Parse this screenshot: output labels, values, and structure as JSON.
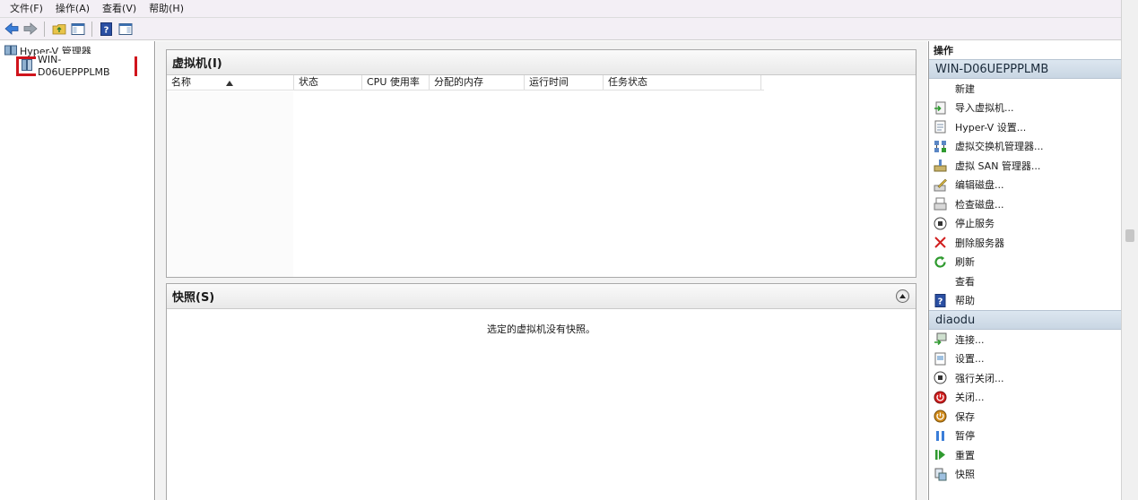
{
  "menu": [
    "文件(F)",
    "操作(A)",
    "查看(V)",
    "帮助(H)"
  ],
  "tree": {
    "root": "Hyper-V 管理器",
    "child": "WIN-D06UEPPPLMB"
  },
  "vm_section": {
    "title": "虚拟机(I)",
    "columns": [
      "名称",
      "状态",
      "CPU 使用率",
      "分配的内存",
      "运行时间",
      "任务状态"
    ]
  },
  "snapshot_section": {
    "title": "快照(S)",
    "message": "选定的虚拟机没有快照。"
  },
  "actions": {
    "title": "操作",
    "server_group": {
      "name": "WIN-D06UEPPPLMB",
      "items": [
        {
          "label": "新建",
          "icon": "none"
        },
        {
          "label": "导入虚拟机...",
          "icon": "import-icon"
        },
        {
          "label": "Hyper-V 设置...",
          "icon": "settings-icon"
        },
        {
          "label": "虚拟交换机管理器...",
          "icon": "switch-icon"
        },
        {
          "label": "虚拟 SAN 管理器...",
          "icon": "san-icon"
        },
        {
          "label": "编辑磁盘...",
          "icon": "edit-disk-icon"
        },
        {
          "label": "检查磁盘...",
          "icon": "inspect-disk-icon"
        },
        {
          "label": "停止服务",
          "icon": "stop-icon"
        },
        {
          "label": "删除服务器",
          "icon": "delete-icon"
        },
        {
          "label": "刷新",
          "icon": "refresh-icon"
        },
        {
          "label": "查看",
          "icon": "none"
        },
        {
          "label": "帮助",
          "icon": "help-icon"
        }
      ]
    },
    "vm_group": {
      "name": "diaodu",
      "items": [
        {
          "label": "连接...",
          "icon": "connect-icon"
        },
        {
          "label": "设置...",
          "icon": "vm-settings-icon"
        },
        {
          "label": "强行关闭...",
          "icon": "turn-off-icon"
        },
        {
          "label": "关闭...",
          "icon": "shutdown-icon"
        },
        {
          "label": "保存",
          "icon": "save-icon"
        },
        {
          "label": "暂停",
          "icon": "pause-icon"
        },
        {
          "label": "重置",
          "icon": "reset-icon"
        },
        {
          "label": "快照",
          "icon": "snapshot-icon"
        }
      ]
    }
  },
  "colors": {
    "selection_border": "#d0141c",
    "group_header": "#c9d6e3",
    "accent_blue": "#3a7dd8"
  }
}
